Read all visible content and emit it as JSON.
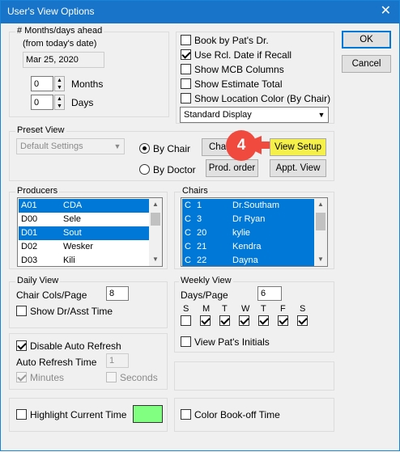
{
  "window": {
    "title": "User's View Options",
    "close_glyph": "✕"
  },
  "buttons": {
    "ok": "OK",
    "cancel": "Cancel"
  },
  "months_group": {
    "label": "# Months/days ahead",
    "sublabel": "(from today's date)",
    "date_value": "Mar 25, 2020",
    "months_value": "0",
    "months_label": "Months",
    "days_value": "0",
    "days_label": "Days"
  },
  "options_group": {
    "items": [
      {
        "label": "Book by Pat's Dr.",
        "checked": false
      },
      {
        "label": "Use Rcl. Date if Recall",
        "checked": true
      },
      {
        "label": "Show MCB Columns",
        "checked": false
      },
      {
        "label": "Show Estimate Total",
        "checked": false
      },
      {
        "label": "Show Location Color (By Chair)",
        "checked": false
      }
    ],
    "display_select": "Standard Display"
  },
  "preset_group": {
    "label": "Preset View",
    "preset_select": "Default Settings",
    "by_chair": "By Chair",
    "by_doctor": "By Doctor",
    "chair_btn": "Cha",
    "view_setup_btn": "View Setup",
    "prod_order_btn": "Prod. order",
    "appt_view_btn": "Appt. View"
  },
  "callout": {
    "number": "4",
    "color": "#f04a3e"
  },
  "producers_group": {
    "label": "Producers",
    "rows": [
      {
        "code": "A01",
        "name": "CDA",
        "selected": true
      },
      {
        "code": "D00",
        "name": "Sele",
        "selected": false
      },
      {
        "code": "D01",
        "name": "Sout",
        "selected": true
      },
      {
        "code": "D02",
        "name": "Wesker",
        "selected": false
      },
      {
        "code": "D03",
        "name": "Kili",
        "selected": false
      }
    ]
  },
  "chairs_group": {
    "label": "Chairs",
    "rows": [
      {
        "c": "C",
        "num": "1",
        "name": "Dr.Southam",
        "selected": true
      },
      {
        "c": "C",
        "num": "3",
        "name": "Dr Ryan",
        "selected": true
      },
      {
        "c": "C",
        "num": "20",
        "name": "kylie",
        "selected": true
      },
      {
        "c": "C",
        "num": "21",
        "name": "Kendra",
        "selected": true
      },
      {
        "c": "C",
        "num": "22",
        "name": "Dayna",
        "selected": true
      }
    ]
  },
  "daily_group": {
    "label": "Daily View",
    "cols_label": "Chair Cols/Page",
    "cols_value": "8",
    "show_dr_asst": "Show Dr/Asst Time"
  },
  "weekly_group": {
    "label": "Weekly View",
    "days_label": "Days/Page",
    "days_value": "6",
    "weekdays": [
      {
        "letter": "S",
        "checked": false
      },
      {
        "letter": "M",
        "checked": true
      },
      {
        "letter": "T",
        "checked": true
      },
      {
        "letter": "W",
        "checked": true
      },
      {
        "letter": "T",
        "checked": true
      },
      {
        "letter": "F",
        "checked": true
      },
      {
        "letter": "S",
        "checked": true
      }
    ],
    "view_initials": "View Pat's Initials"
  },
  "refresh_group": {
    "disable_label": "Disable Auto Refresh",
    "time_label": "Auto Refresh Time",
    "time_value": "1",
    "minutes": "Minutes",
    "seconds": "Seconds"
  },
  "highlight_group": {
    "label": "Highlight Current Time",
    "swatch_color": "#80ff80"
  },
  "bookoff_group": {
    "label": "Color Book-off Time"
  }
}
